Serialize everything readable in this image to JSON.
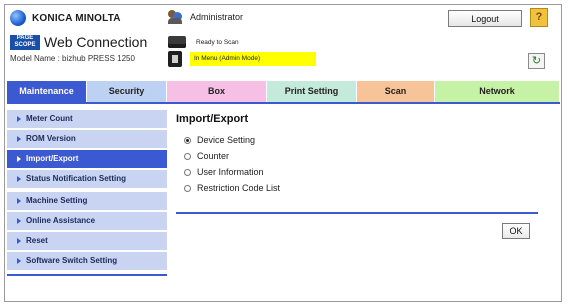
{
  "header": {
    "brand": "KONICA MINOLTA",
    "pagescope_logo": [
      "PAGE",
      "SCOPE"
    ],
    "app_title": "Web Connection",
    "model": "Model Name : bizhub PRESS 1250",
    "user": "Administrator",
    "status_ready": "Ready to Scan",
    "status_mode": "In Menu (Admin Mode)",
    "logout_label": "Logout",
    "help_label": "?",
    "refresh_label": "↻",
    "colors": {
      "status_highlight": "#ffff00",
      "accent": "#3b59d0"
    }
  },
  "tabs": [
    {
      "label": "Maintenance"
    },
    {
      "label": "Security"
    },
    {
      "label": "Box"
    },
    {
      "label": "Print Setting"
    },
    {
      "label": "Scan"
    },
    {
      "label": "Network"
    }
  ],
  "sidebar": {
    "items": [
      {
        "label": "Meter Count"
      },
      {
        "label": "ROM Version"
      },
      {
        "label": "Import/Export"
      },
      {
        "label": "Status Notification Setting"
      },
      {
        "label": "Machine Setting"
      },
      {
        "label": "Online Assistance"
      },
      {
        "label": "Reset"
      },
      {
        "label": "Software Switch Setting"
      }
    ]
  },
  "main": {
    "title": "Import/Export",
    "options": [
      {
        "label": "Device Setting",
        "selected": true
      },
      {
        "label": "Counter"
      },
      {
        "label": "User Information"
      },
      {
        "label": "Restriction Code List"
      }
    ],
    "ok_label": "OK"
  }
}
